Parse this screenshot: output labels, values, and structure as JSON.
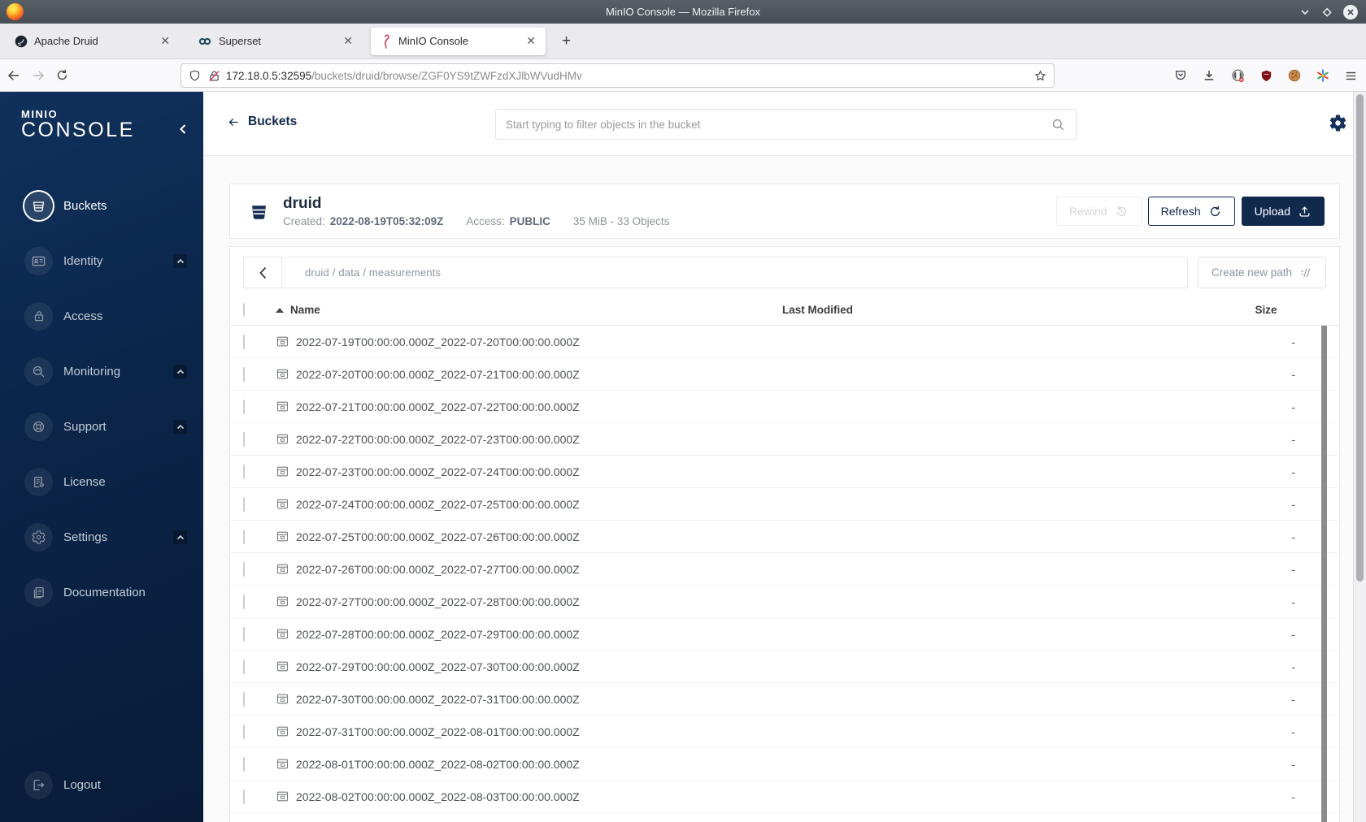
{
  "titlebar": {
    "title": "MinIO Console — Mozilla Firefox"
  },
  "tabs": [
    {
      "label": "Apache Druid",
      "icon": "druid-logo",
      "active": false
    },
    {
      "label": "Superset",
      "icon": "superset-logo",
      "active": false
    },
    {
      "label": "MinIO Console",
      "icon": "minio-flamingo",
      "active": true
    }
  ],
  "navbar": {
    "url_host": "172.18.0.5:32595",
    "url_path": "/buckets/druid/browse/ZGF0YS9tZWFzdXJlbWVudHMv",
    "toolbar_icons": [
      "pocket-icon",
      "download-icon",
      "extension-icon",
      "ublock-shield-icon",
      "cookie-icon",
      "multicolor-extension-icon",
      "menu-icon"
    ]
  },
  "sidebar": {
    "logo_primary": "MINIO",
    "logo_secondary": "CONSOLE",
    "items": [
      {
        "label": "Buckets",
        "icon": "bucket-icon",
        "active": true,
        "expandable": false
      },
      {
        "label": "Identity",
        "icon": "id-card-icon",
        "active": false,
        "expandable": true
      },
      {
        "label": "Access",
        "icon": "lock-icon",
        "active": false,
        "expandable": false
      },
      {
        "label": "Monitoring",
        "icon": "monitor-search-icon",
        "active": false,
        "expandable": true
      },
      {
        "label": "Support",
        "icon": "support-icon",
        "active": false,
        "expandable": true
      },
      {
        "label": "License",
        "icon": "license-icon",
        "active": false,
        "expandable": false
      },
      {
        "label": "Settings",
        "icon": "gear-icon",
        "active": false,
        "expandable": true
      },
      {
        "label": "Documentation",
        "icon": "docs-icon",
        "active": false,
        "expandable": false
      }
    ],
    "logout": {
      "label": "Logout",
      "icon": "logout-icon"
    }
  },
  "header": {
    "back_label": "Buckets",
    "search_placeholder": "Start typing to filter objects in the bucket"
  },
  "bucket": {
    "name": "druid",
    "created_label": "Created:",
    "created_value": "2022-08-19T05:32:09Z",
    "access_label": "Access:",
    "access_value": "PUBLIC",
    "stats": "35 MiB - 33 Objects",
    "buttons": {
      "rewind": "Rewind",
      "refresh": "Refresh",
      "upload": "Upload"
    }
  },
  "browse": {
    "path": "druid / data / measurements",
    "create_path_label": "Create new path",
    "columns": {
      "name": "Name",
      "last_modified": "Last Modified",
      "size": "Size"
    },
    "rows": [
      {
        "name": "2022-07-19T00:00:00.000Z_2022-07-20T00:00:00.000Z",
        "size": "-"
      },
      {
        "name": "2022-07-20T00:00:00.000Z_2022-07-21T00:00:00.000Z",
        "size": "-"
      },
      {
        "name": "2022-07-21T00:00:00.000Z_2022-07-22T00:00:00.000Z",
        "size": "-"
      },
      {
        "name": "2022-07-22T00:00:00.000Z_2022-07-23T00:00:00.000Z",
        "size": "-"
      },
      {
        "name": "2022-07-23T00:00:00.000Z_2022-07-24T00:00:00.000Z",
        "size": "-"
      },
      {
        "name": "2022-07-24T00:00:00.000Z_2022-07-25T00:00:00.000Z",
        "size": "-"
      },
      {
        "name": "2022-07-25T00:00:00.000Z_2022-07-26T00:00:00.000Z",
        "size": "-"
      },
      {
        "name": "2022-07-26T00:00:00.000Z_2022-07-27T00:00:00.000Z",
        "size": "-"
      },
      {
        "name": "2022-07-27T00:00:00.000Z_2022-07-28T00:00:00.000Z",
        "size": "-"
      },
      {
        "name": "2022-07-28T00:00:00.000Z_2022-07-29T00:00:00.000Z",
        "size": "-"
      },
      {
        "name": "2022-07-29T00:00:00.000Z_2022-07-30T00:00:00.000Z",
        "size": "-"
      },
      {
        "name": "2022-07-30T00:00:00.000Z_2022-07-31T00:00:00.000Z",
        "size": "-"
      },
      {
        "name": "2022-07-31T00:00:00.000Z_2022-08-01T00:00:00.000Z",
        "size": "-"
      },
      {
        "name": "2022-08-01T00:00:00.000Z_2022-08-02T00:00:00.000Z",
        "size": "-"
      },
      {
        "name": "2022-08-02T00:00:00.000Z_2022-08-03T00:00:00.000Z",
        "size": "-"
      }
    ]
  },
  "colors": {
    "navy": "#10294d",
    "sidebar_top": "#10315c",
    "sidebar_bottom": "#081c38",
    "accent_red": "#c92c4a"
  }
}
